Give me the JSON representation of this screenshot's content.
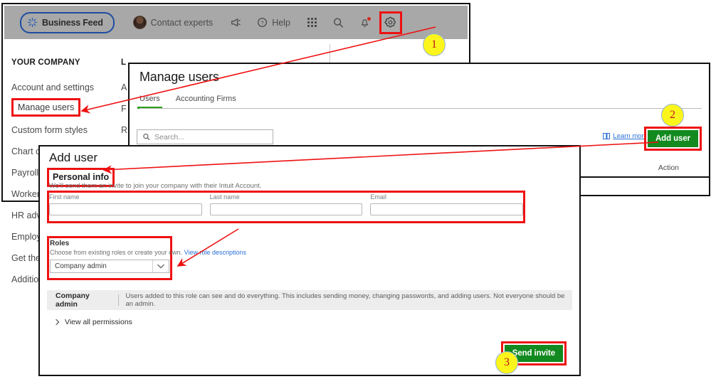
{
  "topbar": {
    "business_feed": "Business Feed",
    "contact_experts": "Contact experts",
    "help": "Help",
    "icons": {
      "business_feed_icon": "spark-icon",
      "avatar": "avatar-icon",
      "megaphone": "megaphone-icon",
      "help": "question-circle-icon",
      "grid": "apps-grid-icon",
      "search": "search-icon",
      "bell": "notification-bell-icon",
      "gear": "gear-icon"
    }
  },
  "sidebar": {
    "heading": "YOUR COMPANY",
    "items": [
      {
        "label": "Account and settings",
        "highlighted": false
      },
      {
        "label": "Manage users",
        "highlighted": true
      },
      {
        "label": "Custom form styles",
        "highlighted": false
      },
      {
        "label": "Chart o",
        "highlighted": false
      },
      {
        "label": "Payroll s",
        "highlighted": false
      },
      {
        "label": "Worker",
        "highlighted": false
      },
      {
        "label": "HR advi",
        "highlighted": false
      },
      {
        "label": "Employ",
        "highlighted": false
      },
      {
        "label": "Get the",
        "highlighted": false
      },
      {
        "label": "Additio",
        "highlighted": false
      }
    ]
  },
  "second_column": {
    "heading": "L",
    "items": [
      "A",
      "F",
      "R"
    ]
  },
  "manage_users": {
    "title": "Manage users",
    "tabs": [
      {
        "label": "Users",
        "active": true
      },
      {
        "label": "Accounting Firms",
        "active": false
      }
    ],
    "search_placeholder": "Search...",
    "learn_more": "Learn more",
    "add_user_button": "Add user",
    "column_header_action": "Action"
  },
  "add_user": {
    "title": "Add user",
    "personal_info_heading": "Personal info",
    "personal_info_sub": "We'll send them an invite to join your company with their Intuit Account.",
    "fields": [
      {
        "label": "First name",
        "value": "",
        "placeholder": ""
      },
      {
        "label": "Last name",
        "value": "",
        "placeholder": ""
      },
      {
        "label": "Email",
        "value": "",
        "placeholder": ""
      }
    ],
    "roles_heading": "Roles",
    "roles_desc": "Choose from existing roles or create your own.",
    "roles_link": "View role descriptions",
    "role_selected": "Company admin",
    "role_options": [
      "Company admin"
    ],
    "role_banner_name": "Company admin",
    "role_banner_desc": "Users added to this role can see and do everything. This includes sending money, changing passwords, and adding users. Not everyone should be an admin.",
    "view_all_permissions": "View all permissions",
    "send_invite_button": "Send invite"
  },
  "callouts": [
    {
      "number": "1",
      "target": "gear-icon"
    },
    {
      "number": "2",
      "target": "add-user-button"
    },
    {
      "number": "3",
      "target": "send-invite-button"
    }
  ],
  "colors": {
    "accent_green": "#138a1f",
    "highlight_red": "#ee1111",
    "badge_yellow": "#fbf51c",
    "badge_text": "#c0151a",
    "tab_active": "#2ca01c",
    "link_blue": "#2a6fd6",
    "topbar_gray": "#a8a8a8"
  }
}
